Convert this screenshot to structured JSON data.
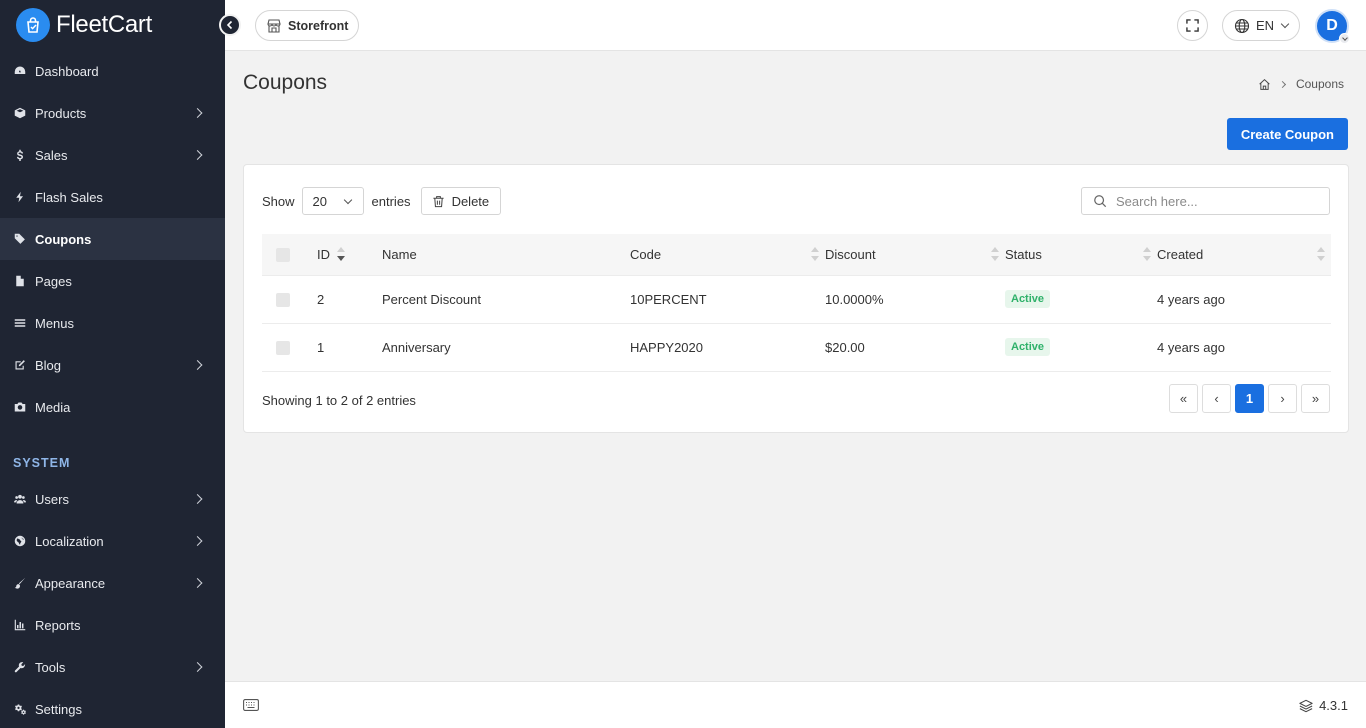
{
  "app": {
    "brand_name": "FleetCart",
    "version": "4.3.1"
  },
  "sidebar": {
    "items": [
      {
        "label": "Dashboard",
        "icon": "dashboard-icon",
        "has_children": false
      },
      {
        "label": "Products",
        "icon": "cube-icon",
        "has_children": true
      },
      {
        "label": "Sales",
        "icon": "dollar-icon",
        "has_children": true
      },
      {
        "label": "Flash Sales",
        "icon": "bolt-icon",
        "has_children": false
      },
      {
        "label": "Coupons",
        "icon": "tags-icon",
        "has_children": false,
        "active": true
      },
      {
        "label": "Pages",
        "icon": "file-icon",
        "has_children": false
      },
      {
        "label": "Menus",
        "icon": "bars-icon",
        "has_children": false
      },
      {
        "label": "Blog",
        "icon": "edit-icon",
        "has_children": true
      },
      {
        "label": "Media",
        "icon": "camera-icon",
        "has_children": false
      }
    ],
    "section_label": "SYSTEM",
    "system_items": [
      {
        "label": "Users",
        "icon": "users-icon",
        "has_children": true
      },
      {
        "label": "Localization",
        "icon": "globe-icon",
        "has_children": true
      },
      {
        "label": "Appearance",
        "icon": "brush-icon",
        "has_children": true
      },
      {
        "label": "Reports",
        "icon": "bar-chart-icon",
        "has_children": false
      },
      {
        "label": "Tools",
        "icon": "wrench-icon",
        "has_children": true
      },
      {
        "label": "Settings",
        "icon": "cogs-icon",
        "has_children": false
      }
    ]
  },
  "topbar": {
    "storefront_label": "Storefront",
    "language": "EN",
    "avatar_initial": "D"
  },
  "page": {
    "title": "Coupons",
    "breadcrumb_current": "Coupons",
    "create_button": "Create Coupon"
  },
  "table_controls": {
    "show_label": "Show",
    "page_size": "20",
    "entries_label": "entries",
    "delete_label": "Delete",
    "search_placeholder": "Search here..."
  },
  "table": {
    "columns": [
      "ID",
      "Name",
      "Code",
      "Discount",
      "Status",
      "Created"
    ],
    "rows": [
      {
        "id": "2",
        "name": "Percent Discount",
        "code": "10PERCENT",
        "discount": "10.0000%",
        "status": "Active",
        "created": "4 years ago"
      },
      {
        "id": "1",
        "name": "Anniversary",
        "code": "HAPPY2020",
        "discount": "$20.00",
        "status": "Active",
        "created": "4 years ago"
      }
    ]
  },
  "pagination": {
    "summary": "Showing 1 to 2 of 2 entries",
    "first": "«",
    "prev": "‹",
    "current": "1",
    "next": "›",
    "last": "»"
  },
  "colors": {
    "sidebar_bg": "#1f2533",
    "primary": "#1a6fe0",
    "active_badge_bg": "#e7f6ec",
    "active_badge_text": "#2fb16a",
    "section_label": "#8fb6e8"
  }
}
